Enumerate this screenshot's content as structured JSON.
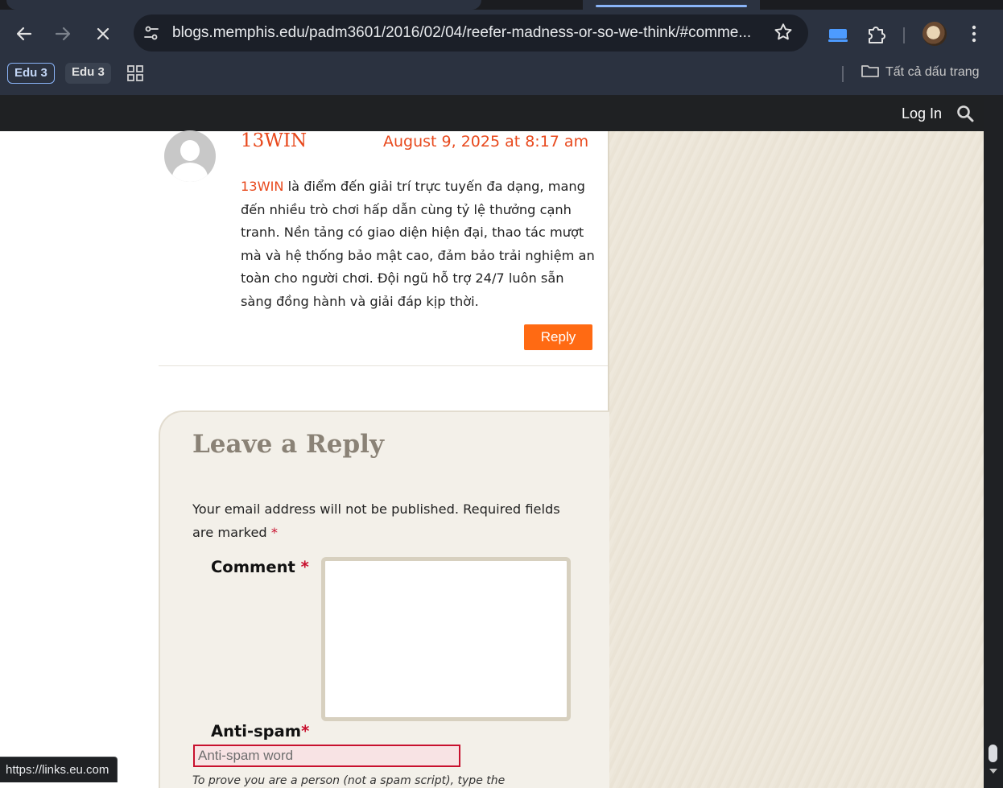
{
  "browser": {
    "url": "blogs.memphis.edu/padm3601/2016/02/04/reefer-madness-or-so-we-think/#comme...",
    "bookmarks": [
      {
        "label": "Edu 3"
      },
      {
        "label": "Edu 3"
      }
    ],
    "all_bookmarks_label": "Tất cả dấu trang",
    "status_url": "https://links.eu.com",
    "accent_color": "#8ab4f8"
  },
  "site": {
    "login_label": "Log In"
  },
  "comment": {
    "author": "13WIN",
    "date": "August 9, 2025 at 8:17 am",
    "keyword": "13WIN",
    "body_rest": " là điểm đến giải trí trực tuyến đa dạng, mang đến nhiều trò chơi hấp dẫn cùng tỷ lệ thưởng cạnh tranh. Nền tảng có giao diện hiện đại, thao tác mượt mà và hệ thống bảo mật cao, đảm bảo trải nghiệm an toàn cho người chơi. Đội ngũ hỗ trợ 24/7 luôn sẵn sàng đồng hành và giải đáp kịp thời.",
    "reply_label": "Reply",
    "link_color": "#e8491d",
    "button_color": "#ff6a13"
  },
  "reply_form": {
    "title": "Leave a Reply",
    "note": "Your email address will not be published. Required fields are marked",
    "required_mark": "*",
    "comment_label": "Comment",
    "comment_value": "",
    "antispam_label": "Anti-spam",
    "antispam_placeholder": "Anti-spam word",
    "antispam_hint": "To prove you are a person (not a spam script), type the"
  }
}
